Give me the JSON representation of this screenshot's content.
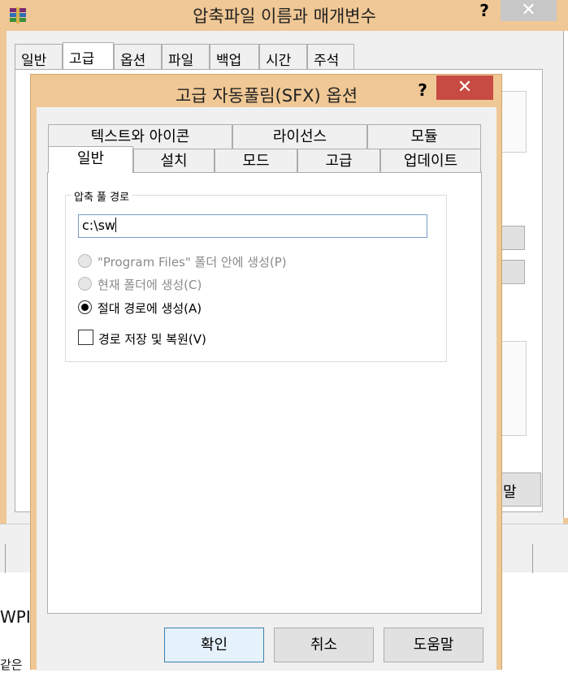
{
  "outer_dialog": {
    "title": "압축파일 이름과 매개변수",
    "help": "?",
    "close": "✕",
    "tabs": [
      "일반",
      "고급",
      "옵션",
      "파일",
      "백업",
      "시간",
      "주석"
    ],
    "selected_tab": "고급",
    "help_button_partial": "말"
  },
  "background": {
    "text1": "WPI",
    "text2": "같은"
  },
  "sfx_dialog": {
    "title": "고급 자동풀림(SFX) 옵션",
    "help": "?",
    "close": "✕",
    "tabs_row1": [
      "텍스트와 아이콘",
      "라이선스",
      "모듈"
    ],
    "tabs_row2": [
      "일반",
      "설치",
      "모드",
      "고급",
      "업데이트"
    ],
    "selected_tab": "일반",
    "group_label": "압축 풀 경로",
    "path_value": "c:\\sw",
    "options": [
      {
        "label": "\"Program Files\" 폴더 안에 생성(P)",
        "enabled": false,
        "checked": false
      },
      {
        "label": "현재 폴더에 생성(C)",
        "enabled": false,
        "checked": false
      },
      {
        "label": "절대 경로에 생성(A)",
        "enabled": true,
        "checked": true
      }
    ],
    "checkbox_label": "경로 저장 및 복원(V)",
    "checkbox_checked": false,
    "buttons": {
      "ok": "확인",
      "cancel": "취소",
      "help": "도움말"
    }
  }
}
